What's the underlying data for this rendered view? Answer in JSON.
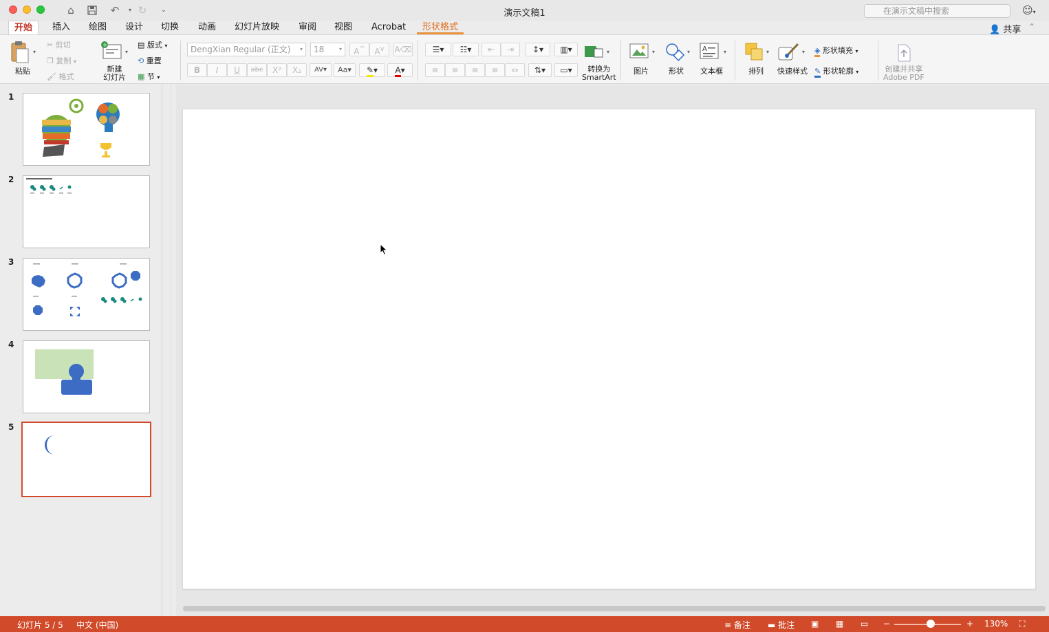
{
  "window": {
    "title": "演示文稿1",
    "search_placeholder": "在演示文稿中搜索"
  },
  "tabs": [
    "开始",
    "插入",
    "绘图",
    "设计",
    "切换",
    "动画",
    "幻灯片放映",
    "审阅",
    "视图",
    "Acrobat",
    "形状格式"
  ],
  "active_tab": "开始",
  "share_label": "共享",
  "ribbon": {
    "paste": "粘贴",
    "cut": "剪切",
    "copy": "复制",
    "format": "格式",
    "new_slide_line1": "新建",
    "new_slide_line2": "幻灯片",
    "layout": "版式",
    "reset": "重置",
    "section": "节",
    "font_name": "DengXian Regular (正文)",
    "font_size": "18",
    "convert_line1": "转换为",
    "convert_line2": "SmartArt",
    "picture": "图片",
    "shape": "形状",
    "textbox": "文本框",
    "arrange": "排列",
    "quick_styles": "快速样式",
    "shape_fill": "形状填充",
    "shape_outline": "形状轮廓",
    "acrobat_line1": "创建并共享",
    "acrobat_line2": "Adobe PDF"
  },
  "slides": [
    {
      "number": "1"
    },
    {
      "number": "2"
    },
    {
      "number": "3"
    },
    {
      "number": "4"
    },
    {
      "number": "5"
    }
  ],
  "status": {
    "slide_info": "幻灯片 5 / 5",
    "language": "中文 (中国)",
    "notes": "备注",
    "comments": "批注",
    "zoom": "130%"
  },
  "colors": {
    "accent": "#d14b2b",
    "shape_format_tab": "#e06c1a"
  }
}
